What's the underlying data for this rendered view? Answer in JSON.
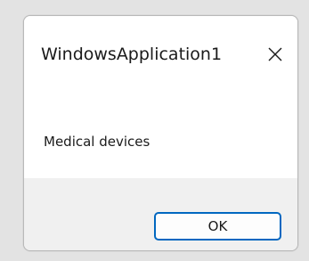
{
  "window": {
    "title": "WindowsApplication1"
  },
  "message": {
    "text": "Medical devices"
  },
  "buttons": {
    "ok_label": "OK"
  },
  "icons": {
    "close": "close-icon"
  },
  "colors": {
    "accent": "#0067c0",
    "footer_bg": "#f0f0f0",
    "backdrop": "#e3e3e3"
  }
}
